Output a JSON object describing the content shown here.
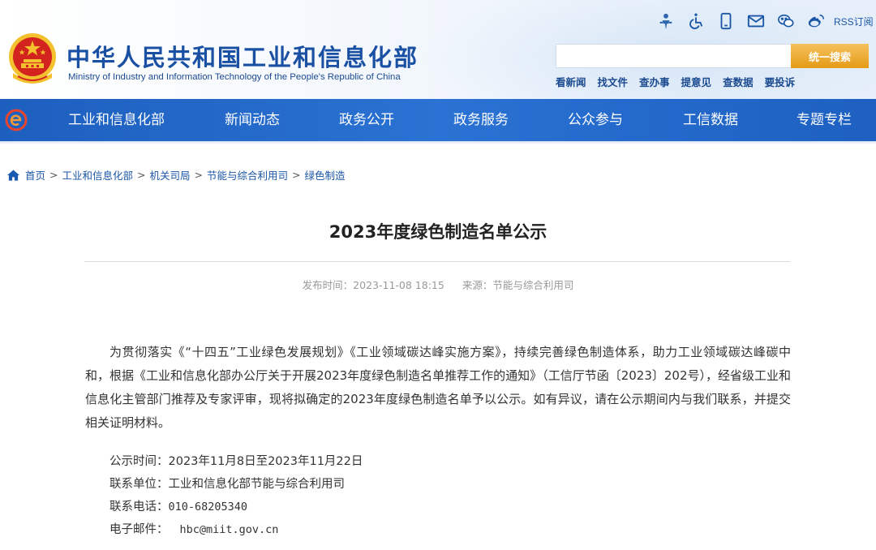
{
  "header": {
    "site_title": "中华人民共和国工业和信息化部",
    "site_subtitle": "Ministry of Industry and Information Technology of the People's Republic of China",
    "rss_label": "RSS订阅",
    "search": {
      "placeholder": "",
      "button_label": "统一搜索"
    },
    "quick_links": [
      "看新闻",
      "找文件",
      "查办事",
      "提意见",
      "查数据",
      "要投诉"
    ],
    "top_icons": [
      "elder-care-icon",
      "accessibility-icon",
      "mobile-icon",
      "mail-icon",
      "wechat-icon",
      "weibo-icon",
      "rss-icon"
    ]
  },
  "nav": {
    "items": [
      "工业和信息化部",
      "新闻动态",
      "政务公开",
      "政务服务",
      "公众参与",
      "工信数据",
      "专题专栏"
    ]
  },
  "breadcrumb": {
    "items": [
      "首页",
      "工业和信息化部",
      "机关司局",
      "节能与综合利用司",
      "绿色制造"
    ],
    "separator": ">"
  },
  "article": {
    "title": "2023年度绿色制造名单公示",
    "publish_time_label": "发布时间：",
    "publish_time": "2023-11-08 18:15",
    "source_label": "来源：",
    "source": "节能与综合利用司",
    "paragraph": "为贯彻落实《“十四五”工业绿色发展规划》《工业领域碳达峰实施方案》，持续完善绿色制造体系，助力工业领域碳达峰碳中和，根据《工业和信息化部办公厅关于开展2023年度绿色制造名单推荐工作的通知》（工信厅节函〔2023〕202号），经省级工业和信息化主管部门推荐及专家评审，现将拟确定的2023年度绿色制造名单予以公示。如有异议，请在公示期间内与我们联系，并提交相关证明材料。",
    "info": [
      {
        "label": "公示时间：",
        "value": "2023年11月8日至2023年11月22日"
      },
      {
        "label": "联系单位：",
        "value": "工业和信息化部节能与综合利用司"
      },
      {
        "label": "联系电话：",
        "value": "010-68205340"
      },
      {
        "label": "电子邮件：",
        "value": "hbc@miit.gov.cn"
      }
    ]
  },
  "colors": {
    "brand_blue": "#1a50a3",
    "nav_blue": "#2a72d3",
    "search_orange": "#e59b17",
    "emblem_red": "#d3231e",
    "emblem_gold": "#f4c12e"
  }
}
